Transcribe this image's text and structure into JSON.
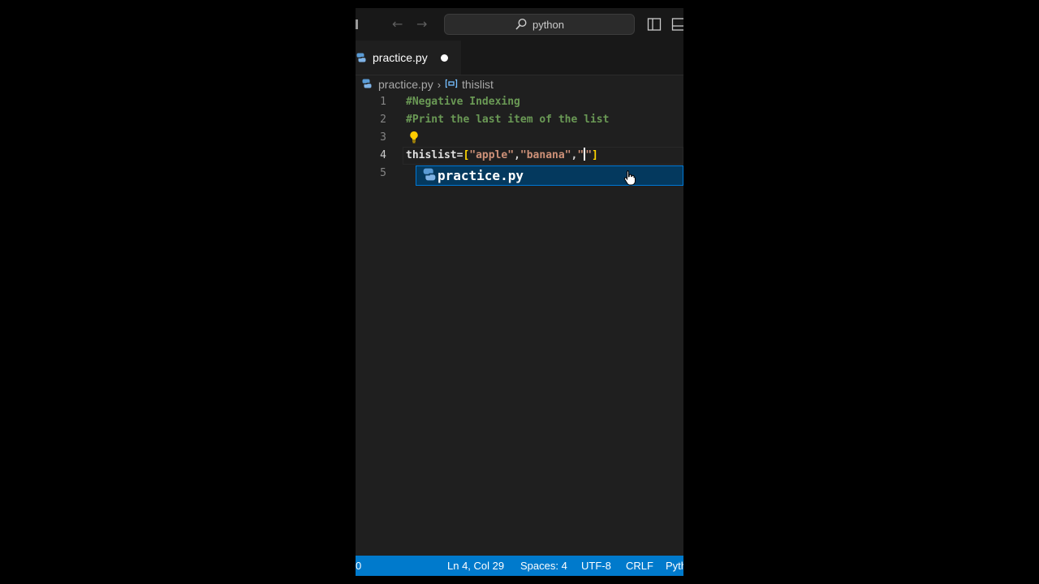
{
  "search": {
    "text": "python"
  },
  "tabs": [
    {
      "label": "practice.py",
      "dirty": true
    }
  ],
  "breadcrumb": {
    "file": "practice.py",
    "symbol": "thislist"
  },
  "editor": {
    "line_numbers": [
      "1",
      "2",
      "3",
      "4",
      "5"
    ],
    "line1": "#Negative Indexing",
    "line2": "#Print the last item of the list",
    "line4": {
      "var": "thislist",
      "eq": "=",
      "open": "[",
      "s1": "\"apple\"",
      "c1": ",",
      "s2": "\"banana\"",
      "c2": ",",
      "q1": "\"",
      "q2": "\"",
      "close": "]"
    }
  },
  "suggestion": {
    "label": "practice.py"
  },
  "statusbar": {
    "left": "0",
    "position": "Ln 4, Col 29",
    "spaces": "Spaces: 4",
    "encoding": "UTF-8",
    "eol": "CRLF",
    "language": "Pyth"
  },
  "colors": {
    "accent": "#007acc",
    "comment": "#6a9955",
    "string": "#ce9178",
    "bracket": "#ffd700",
    "suggest_bg": "#04395e"
  },
  "icons": [
    "arrow-left-icon",
    "arrow-right-icon",
    "search-icon",
    "layout-sidebar-icon",
    "layout-panel-icon",
    "python-icon",
    "symbol-variable-icon",
    "lightbulb-icon",
    "hand-cursor-icon"
  ]
}
